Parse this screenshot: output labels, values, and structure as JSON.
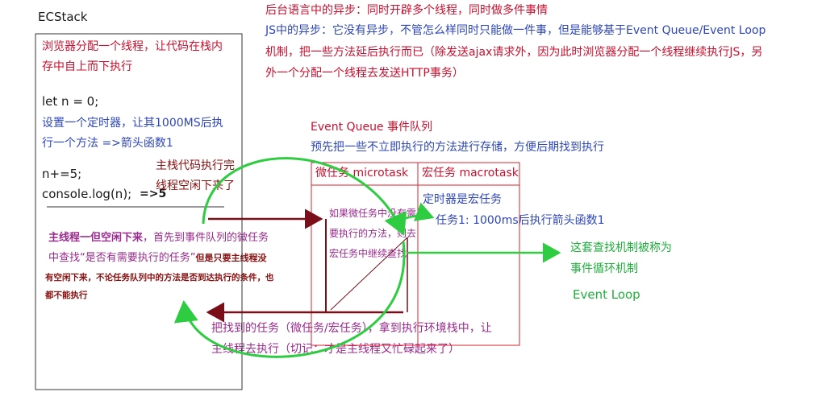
{
  "stack": {
    "title": "ECStack",
    "line1": "浏览器分配一个线程，让代码在栈内",
    "line2": "存中自上而下执行",
    "code1": "let n = 0;",
    "timer1": "设置一个定时器，让其1000MS后执",
    "timer2": "行一个方法  =>箭头函数1",
    "code2": "n+=5;",
    "code3": "console.log(n);",
    "output": "=>5",
    "main_thread_1a": "主线程一但空闲下来",
    "main_thread_1b": "，首先到事件队列的微任务",
    "main_thread_2a": "中查找“是否有需要执行的任务”",
    "main_thread_2b": "但是只要主线程没",
    "main_thread_3": "有空闲下来，不论任务队列中的方法是否到达执行的条件，也",
    "main_thread_4": "都不能执行"
  },
  "intro": {
    "line1": "后台语言中的异步：同时开辟多个线程，同时做多件事情",
    "line2": "JS中的异步：它没有异步，不管怎么样同时只能做一件事，但是能够基于Event Queue/Event Loop",
    "line3": "机制，把一些方法延后执行而已（除发送ajax请求外，因为此时浏览器分配一个线程继续执行JS，另",
    "line4": "外一个分配一个线程去发送HTTP事务）"
  },
  "queue": {
    "title": "Event Queue  事件队列",
    "desc": "预先把一些不立即执行的方法进行存储，方便后期找到执行",
    "micro_header": "微任务 microtask",
    "macro_header": "宏任务 macrotask",
    "micro_1": "如果微任务中没有需",
    "micro_2": "要执行的方法，则去",
    "micro_3": "宏任务中继续查找",
    "macro_1": "定时器是宏任务",
    "macro_2": "任务1:  1000ms后执行箭头函数1"
  },
  "annotations": {
    "stack_done_1": "主栈代码执行完",
    "stack_done_2": "线程空闲下来了",
    "return_1": "把找到的任务（微任务/宏任务），拿到执行环境栈中，让",
    "return_2": "主线程去执行（切记：才是主线程又忙碌起来了）",
    "loop_1": "这套查找机制被称为",
    "loop_2": "事件循环机制",
    "loop_3": "Event Loop"
  }
}
